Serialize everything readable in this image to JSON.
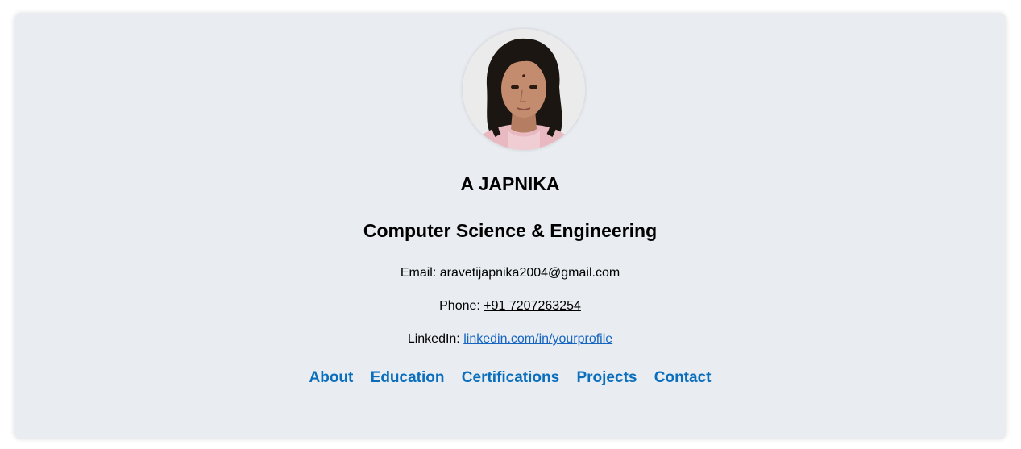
{
  "profile": {
    "name": "A JAPNIKA",
    "title": "Computer Science & Engineering",
    "avatar_icon": "profile-photo"
  },
  "contact": {
    "email_label": "Email:",
    "email_value": "aravetijapnika2004@gmail.com",
    "phone_label": "Phone:",
    "phone_value": "+91 7207263254",
    "linkedin_label": "LinkedIn:",
    "linkedin_value": "linkedin.com/in/yourprofile"
  },
  "nav": {
    "items": [
      {
        "label": "About"
      },
      {
        "label": "Education"
      },
      {
        "label": "Certifications"
      },
      {
        "label": "Projects"
      },
      {
        "label": "Contact"
      }
    ]
  },
  "colors": {
    "card_bg": "#e9edf1",
    "nav_link": "#0a6ebd",
    "profile_link": "#1565c0"
  }
}
